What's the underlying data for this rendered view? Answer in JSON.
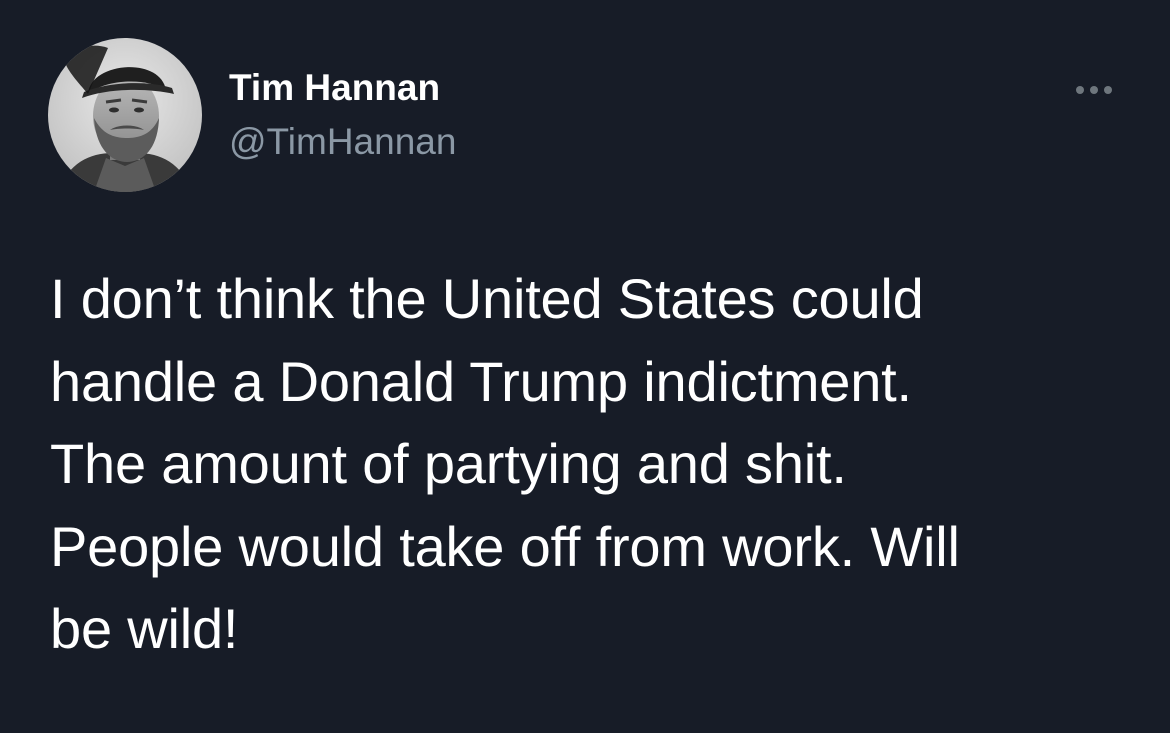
{
  "tweet": {
    "author": {
      "display_name": "Tim Hannan",
      "handle": "@TimHannan",
      "avatar_icon": "user-avatar-photo"
    },
    "more_icon": "more-horizontal-icon",
    "text_lines": [
      "I don’t think the United States could",
      "handle a Donald Trump indictment.",
      "The amount of partying and shit.",
      "People would take off from work. Will",
      "be wild!"
    ]
  },
  "colors": {
    "background": "#171c27",
    "primary_text": "#ffffff",
    "secondary_text": "#8b98a5"
  }
}
